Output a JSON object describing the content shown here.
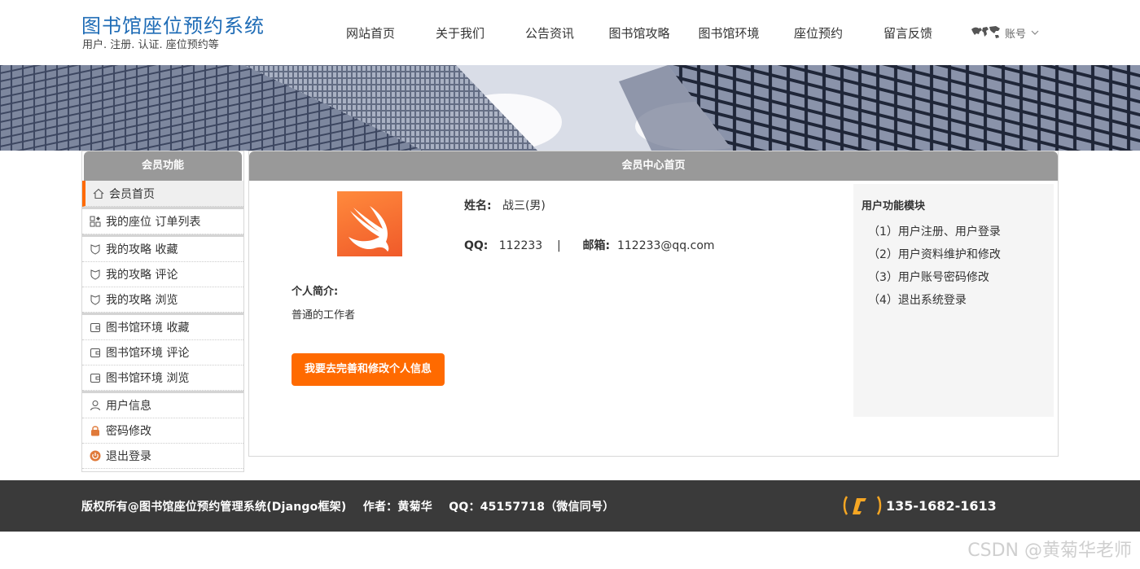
{
  "header": {
    "title": "图书馆座位预约系统",
    "subtitle": "用户. 注册. 认证. 座位预约等",
    "nav": [
      "网站首页",
      "关于我们",
      "公告资讯",
      "图书馆攻略",
      "图书馆环境",
      "座位预约",
      "留言反馈"
    ],
    "account_label": "账号"
  },
  "sidebar": {
    "title": "会员功能",
    "items": [
      {
        "label": "会员首页",
        "icon": "home-icon"
      },
      {
        "label": "我的座位 订单列表",
        "icon": "grid-icon"
      },
      {
        "label": "我的攻略 收藏",
        "icon": "shield-icon"
      },
      {
        "label": "我的攻略 评论",
        "icon": "shield-icon"
      },
      {
        "label": "我的攻略 浏览",
        "icon": "shield-icon"
      },
      {
        "label": "图书馆环境 收藏",
        "icon": "wallet-icon"
      },
      {
        "label": "图书馆环境 评论",
        "icon": "wallet-icon"
      },
      {
        "label": "图书馆环境 浏览",
        "icon": "wallet-icon"
      },
      {
        "label": "用户信息",
        "icon": "user-icon"
      },
      {
        "label": "密码修改",
        "icon": "lock-icon"
      },
      {
        "label": "退出登录",
        "icon": "power-icon"
      }
    ]
  },
  "main": {
    "title": "会员中心首页",
    "name_label": "姓名:",
    "name_value": "战三(男)",
    "qq_label": "QQ:",
    "qq_value": "112233",
    "separator": "|",
    "email_label": "邮箱:",
    "email_value": "112233@qq.com",
    "intro_label": "个人简介:",
    "intro_text": "普通的工作者",
    "edit_button": "我要去完善和修改个人信息"
  },
  "module": {
    "title": "用户功能模块",
    "items": [
      "（1）用户注册、用户登录",
      "（2）用户资料维护和修改",
      "（3）用户账号密码修改",
      "（4）退出系统登录"
    ]
  },
  "footer": {
    "copyright": "版权所有@图书馆座位预约管理系统(Django框架)    作者：黄菊华    QQ：45157718（微信同号）",
    "phone": "135-1682-1613"
  },
  "watermark": "CSDN @黄菊华老师",
  "colors": {
    "brand": "#1f6cb6",
    "accent": "#ff6a00",
    "header_gray": "#999999",
    "footer_bg": "#3a3a3a"
  }
}
